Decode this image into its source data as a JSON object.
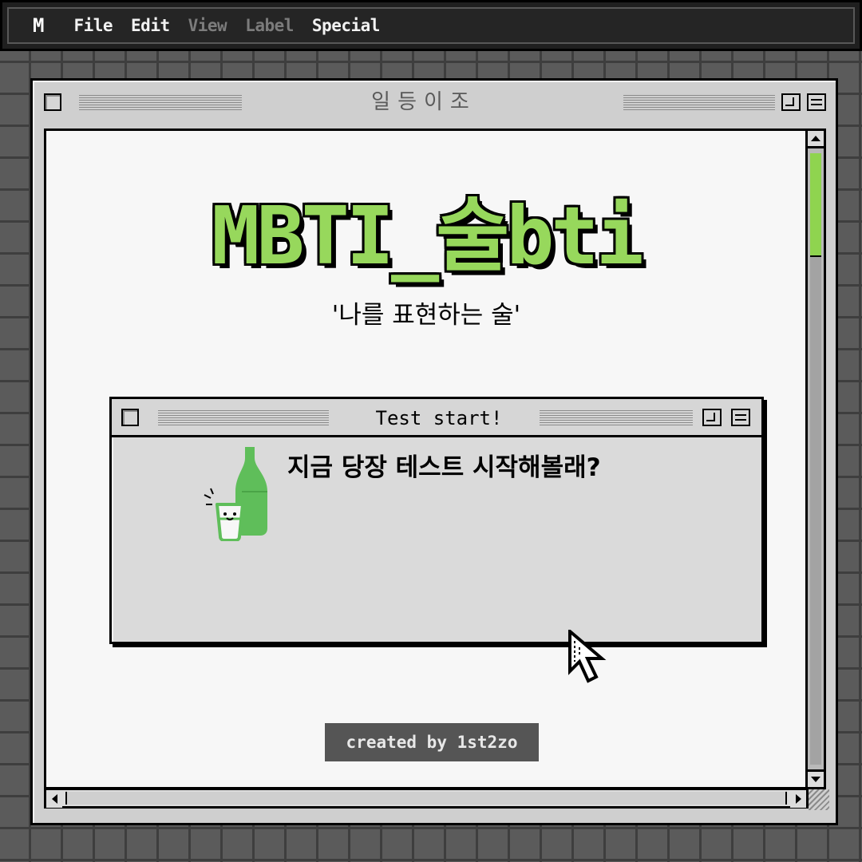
{
  "menubar": {
    "logo": "M",
    "items": [
      {
        "label": "File",
        "enabled": true
      },
      {
        "label": "Edit",
        "enabled": true
      },
      {
        "label": "View",
        "enabled": false
      },
      {
        "label": "Label",
        "enabled": false
      },
      {
        "label": "Special",
        "enabled": true
      }
    ]
  },
  "window": {
    "title": "일등이조",
    "heading": "MBTI_술bti",
    "subtitle": "'나를 표현하는 술'",
    "dialog": {
      "title": "Test start!",
      "message": "지금 당장 테스트 시작해볼래?",
      "illustration": "soju-bottle-and-glass"
    },
    "credit": "created by 1st2zo"
  },
  "colors": {
    "accent": "#97d85c",
    "scroll_thumb": "#8fd44f",
    "desktop": "#5b5b5b",
    "menubar": "#252525",
    "credit_bg": "#555555"
  },
  "scroll": {
    "vertical_position": 0.0
  }
}
